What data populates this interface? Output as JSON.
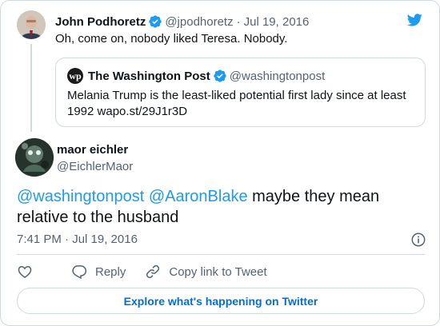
{
  "tweet": {
    "author_name": "John Podhoretz",
    "author_handle": "@jpodhoretz",
    "separator": "·",
    "date": "Jul 19, 2016",
    "text": "Oh, come on, nobody liked Teresa. Nobody.",
    "verified": true
  },
  "quoted_tweet": {
    "logo_text": "wp",
    "author_name": "The Washington Post",
    "author_handle": "@washingtonpost",
    "text": "Melania Trump is the least-liked potential first lady since at least 1992 wapo.st/29J1r3D",
    "verified": true
  },
  "reply": {
    "author_name": "maor eichler",
    "author_handle": "@EichlerMaor",
    "mention_1": "@washingtonpost",
    "mention_2": "@AaronBlake",
    "text": " maybe they mean relative to the husband",
    "timestamp": "7:41 PM · Jul 19, 2016"
  },
  "actions": {
    "reply_label": "Reply",
    "copy_link_label": "Copy link to Tweet"
  },
  "footer": {
    "explore_label": "Explore what's happening on Twitter"
  },
  "icons": {
    "brand": "twitter-bird-icon",
    "verified": "verified-badge-icon",
    "like": "heart-icon",
    "reply": "reply-bubble-icon",
    "copy_link": "link-icon",
    "info": "info-icon"
  },
  "colors": {
    "twitter_blue": "#1d9bf0",
    "verified_blue": "#1d9bf0",
    "link": "#006fd6",
    "secondary_text": "#536471",
    "border": "#cfd9de"
  }
}
